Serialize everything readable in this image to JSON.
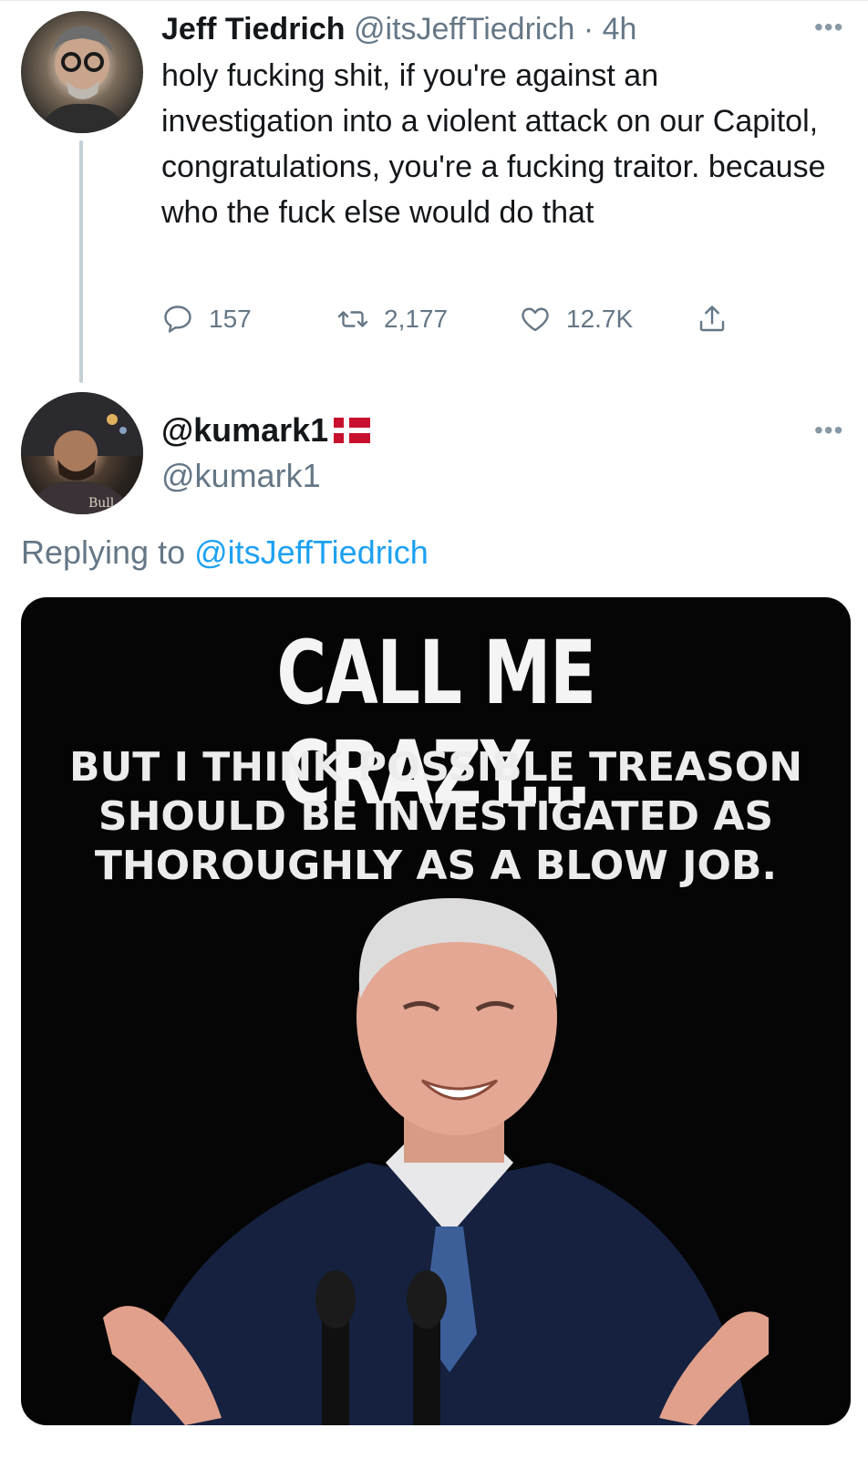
{
  "tweet1": {
    "name": "Jeff Tiedrich",
    "handle": "@itsJeffTiedrich",
    "separator": " · ",
    "time": "4h",
    "text": "holy fucking shit, if you're against an investigation into a violent attack on our Capitol, congratulations, you're a fucking traitor. because who the fuck else would do that",
    "replies": "157",
    "retweets": "2,177",
    "likes": "12.7K",
    "more": "•••"
  },
  "tweet2": {
    "name": "@kumark1",
    "handle": "@kumark1",
    "more": "•••",
    "replying_prefix": "Replying to ",
    "replying_to": "@itsJeffTiedrich"
  },
  "meme": {
    "title": "CALL ME CRAZY...",
    "line1": "BUT I THINK POSSIBLE TREASON",
    "line2": "SHOULD BE INVESTIGATED AS",
    "line3": "THOROUGHLY AS A BLOW JOB."
  },
  "colors": {
    "link": "#1da1f2",
    "secondary_text": "#657786",
    "thread_line": "#c4cfd6"
  },
  "icons": [
    "reply-icon",
    "retweet-icon",
    "like-icon",
    "share-icon",
    "more-icon",
    "flag-denmark"
  ]
}
